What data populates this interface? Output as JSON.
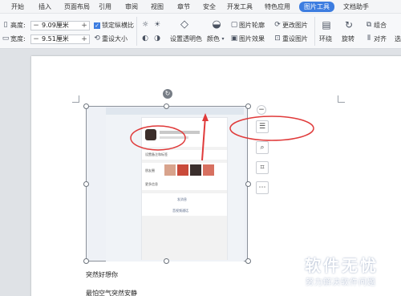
{
  "menubar": {
    "items": [
      "开始",
      "插入",
      "页面布局",
      "引用",
      "审阅",
      "视图",
      "章节",
      "安全",
      "开发工具",
      "特色应用",
      "图片工具",
      "文档助手"
    ],
    "active_index": 10
  },
  "ribbon": {
    "height_label": "高度:",
    "height_value": "9.09厘米",
    "width_label": "宽度:",
    "width_value": "9.51厘米",
    "lock_ratio_label": "锁定纵横比",
    "reset_size_label": "重设大小",
    "set_transparent_label": "设置透明色",
    "color_label": "颜色",
    "picture_outline_label": "图片轮廓",
    "picture_effect_label": "图片效果",
    "change_picture_label": "更改图片",
    "reset_picture_label": "重设图片",
    "wrap_label": "环绕",
    "rotate_label": "旋转",
    "group_label": "组合",
    "align_label": "对齐",
    "select_label": "选"
  },
  "document": {
    "line1": "突然好想你",
    "line2": "最怕空气突然安静"
  },
  "phone_screen": {
    "settings_label": "设置备注和标签",
    "moments_label": "朋友圈",
    "more_label": "更多信息",
    "send_message_label": "发消息",
    "video_call_label": "音视频通话"
  },
  "watermark": {
    "logo": "软件无忧",
    "subtitle": "努力解决软件问题"
  },
  "colors": {
    "accent": "#3d7de0",
    "annotation": "#e03a3a"
  },
  "icons": [
    "minus-icon",
    "plus-icon",
    "reset-size-icon",
    "transparent-color-icon",
    "color-icon",
    "picture-outline-icon",
    "picture-effect-icon",
    "change-picture-icon",
    "reset-picture-icon",
    "wrap-icon",
    "rotate-icon",
    "group-icon",
    "align-icon",
    "layout-options-icon",
    "zoom-icon",
    "crop-icon",
    "more-icon",
    "rotate-handle-icon"
  ]
}
